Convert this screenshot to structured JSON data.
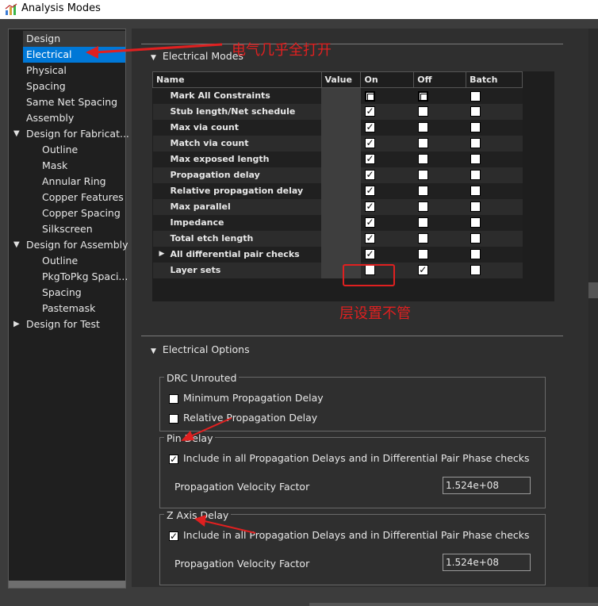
{
  "window": {
    "title": "Analysis Modes"
  },
  "sidebar": {
    "items": [
      {
        "label": "Design",
        "level": 0,
        "selected": false
      },
      {
        "label": "Electrical",
        "level": 0,
        "selected": true
      },
      {
        "label": "Physical",
        "level": 0
      },
      {
        "label": "Spacing",
        "level": 0
      },
      {
        "label": "Same Net Spacing",
        "level": 0
      },
      {
        "label": "Assembly",
        "level": 0
      },
      {
        "label": "Design for Fabricat...",
        "level": 0,
        "expanded": true
      },
      {
        "label": "Outline",
        "level": 1
      },
      {
        "label": "Mask",
        "level": 1
      },
      {
        "label": "Annular Ring",
        "level": 1
      },
      {
        "label": "Copper Features",
        "level": 1
      },
      {
        "label": "Copper Spacing",
        "level": 1
      },
      {
        "label": "Silkscreen",
        "level": 1
      },
      {
        "label": "Design for Assembly",
        "level": 0,
        "expanded": true
      },
      {
        "label": "Outline",
        "level": 1
      },
      {
        "label": "PkgToPkg Spaci...",
        "level": 1
      },
      {
        "label": "Spacing",
        "level": 1
      },
      {
        "label": "Pastemask",
        "level": 1
      },
      {
        "label": "Design for Test",
        "level": 0,
        "expanded": false
      }
    ]
  },
  "electrical_modes": {
    "title": "Electrical Modes",
    "columns": [
      "Name",
      "Value",
      "On",
      "Off",
      "Batch"
    ],
    "rows": [
      {
        "name": "Mark All Constraints",
        "on": "bold",
        "off": "bold",
        "batch": "empty"
      },
      {
        "name": "Stub length/Net schedule",
        "on": "checked",
        "off": "empty",
        "batch": "empty"
      },
      {
        "name": "Max via count",
        "on": "checked",
        "off": "empty",
        "batch": "empty"
      },
      {
        "name": "Match via count",
        "on": "checked",
        "off": "empty",
        "batch": "empty"
      },
      {
        "name": "Max exposed length",
        "on": "checked",
        "off": "empty",
        "batch": "empty"
      },
      {
        "name": "Propagation delay",
        "on": "checked",
        "off": "empty",
        "batch": "empty"
      },
      {
        "name": "Relative propagation delay",
        "on": "checked",
        "off": "empty",
        "batch": "empty"
      },
      {
        "name": "Max parallel",
        "on": "checked",
        "off": "empty",
        "batch": "empty"
      },
      {
        "name": "Impedance",
        "on": "checked",
        "off": "empty",
        "batch": "empty"
      },
      {
        "name": "Total etch length",
        "on": "checked",
        "off": "empty",
        "batch": "empty"
      },
      {
        "name": "All differential pair checks",
        "on": "checked",
        "off": "empty",
        "batch": "empty",
        "expandable": true
      },
      {
        "name": "Layer sets",
        "on": "empty",
        "off": "checked",
        "batch": "empty"
      }
    ]
  },
  "electrical_options": {
    "title": "Electrical Options",
    "drc_unrouted": {
      "label": "DRC Unrouted",
      "options": [
        {
          "label": "Minimum Propagation Delay",
          "checked": false
        },
        {
          "label": "Relative Propagation Delay",
          "checked": false
        }
      ]
    },
    "pin_delay": {
      "label": "Pin Delay",
      "include_label": "Include in all Propagation Delays and in Differential Pair Phase checks",
      "include_checked": true,
      "velocity_label": "Propagation Velocity Factor",
      "velocity_value": "1.524e+08"
    },
    "z_axis_delay": {
      "label": "Z Axis Delay",
      "include_label": "Include in all Propagation Delays and in Differential Pair Phase checks",
      "include_checked": true,
      "velocity_label": "Propagation Velocity Factor",
      "velocity_value": "1.524e+08"
    }
  },
  "annotations": {
    "electrical_note": "电气几乎全打开",
    "layer_note": "层设置不管",
    "color": "#e02020"
  },
  "colors": {
    "selection": "#0078d7",
    "background": "#2f2f2f"
  }
}
